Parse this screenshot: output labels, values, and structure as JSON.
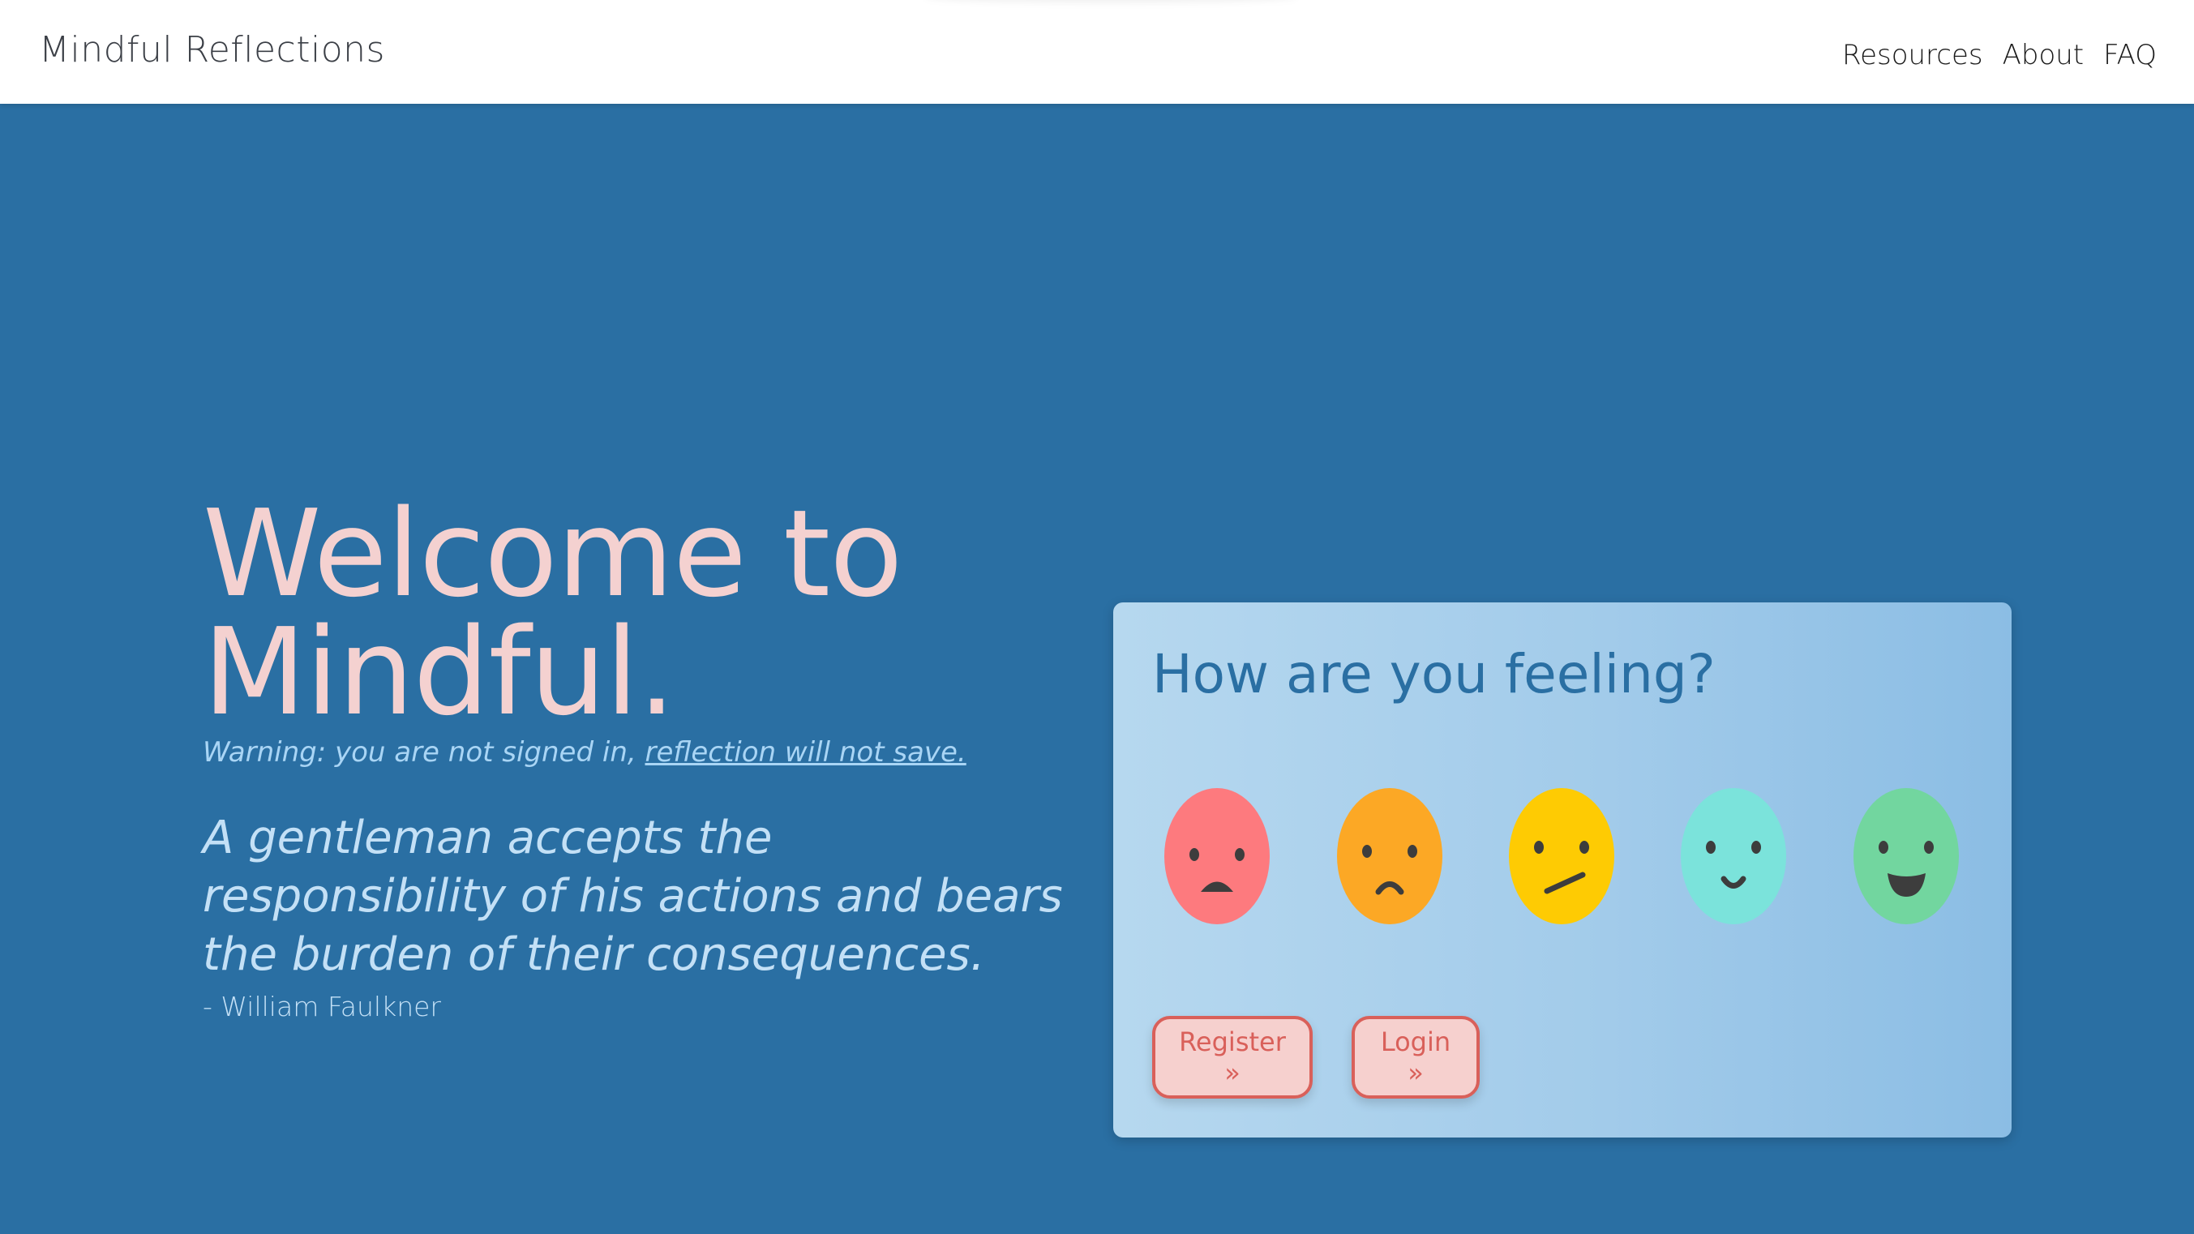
{
  "navbar": {
    "brand": "Mindful Reflections",
    "links": [
      {
        "label": "Resources"
      },
      {
        "label": "About"
      },
      {
        "label": "FAQ"
      }
    ]
  },
  "hero": {
    "welcome_line1": "Welcome to",
    "welcome_line2": "Mindful.",
    "warning_prefix": "Warning: you are not signed in, ",
    "warning_link": "reflection will not save.",
    "quote": "A gentleman accepts the responsibility of his actions and bears the burden of their consequences.",
    "author": "- William Faulkner"
  },
  "mood_card": {
    "title": "How are you feeling?",
    "faces": [
      {
        "mood": "very-sad",
        "color": "#fd7a7e"
      },
      {
        "mood": "sad",
        "color": "#fca825"
      },
      {
        "mood": "neutral",
        "color": "#fecb03"
      },
      {
        "mood": "happy",
        "color": "#7be3db"
      },
      {
        "mood": "very-happy",
        "color": "#72d69f"
      }
    ],
    "register_label": "Register »",
    "login_label": "Login »"
  },
  "colors": {
    "background": "#2a6fa3",
    "accent_pink": "#f4d1d0",
    "button_red": "#d9605a"
  }
}
